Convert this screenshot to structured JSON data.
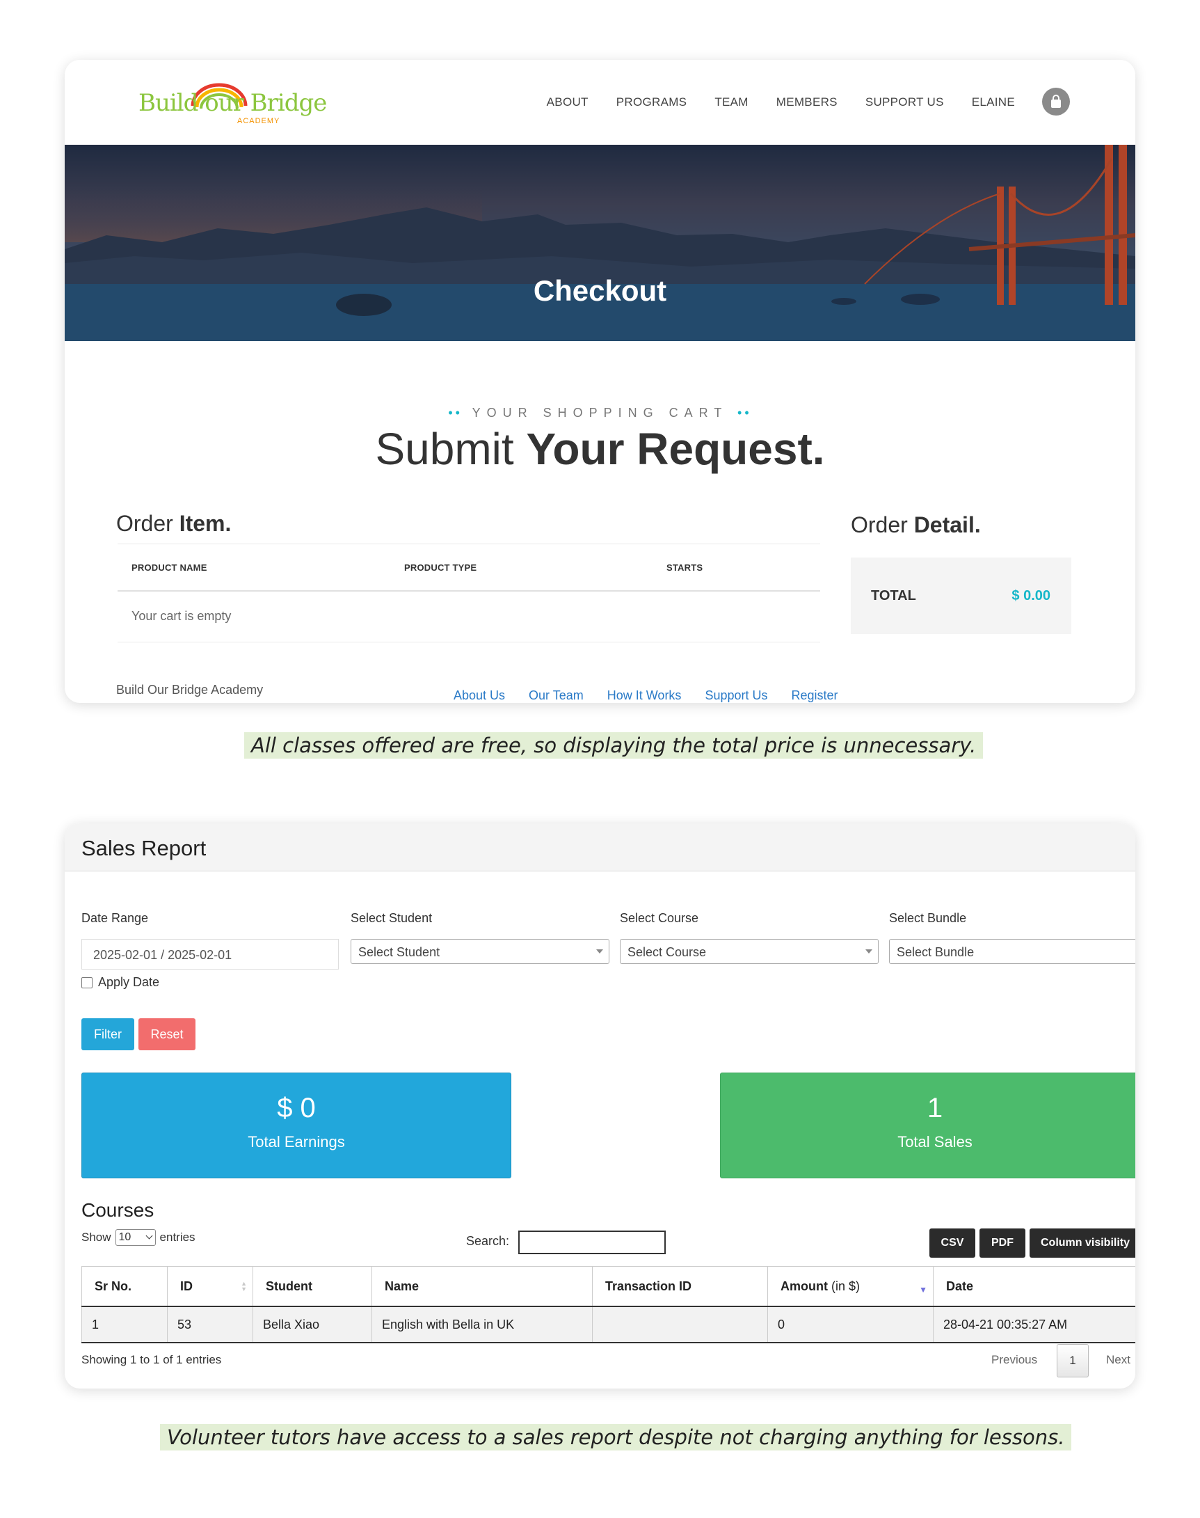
{
  "checkout": {
    "logo": {
      "text": "Build our Bridge",
      "sub": "ACADEMY"
    },
    "nav": [
      "ABOUT",
      "PROGRAMS",
      "TEAM",
      "MEMBERS",
      "SUPPORT US",
      "ELAINE"
    ],
    "hero_title": "Checkout",
    "eyebrow_dots": "••",
    "eyebrow": "YOUR SHOPPING CART",
    "title_light": "Submit ",
    "title_bold": "Your Request.",
    "order_item_light": "Order ",
    "order_item_bold": "Item.",
    "order_detail_light": "Order ",
    "order_detail_bold": "Detail.",
    "columns": [
      "PRODUCT NAME",
      "PRODUCT TYPE",
      "STARTS"
    ],
    "empty_message": "Your cart is empty",
    "total_label": "TOTAL",
    "total_value": "$ 0.00",
    "footer_brand": "Build Our Bridge Academy",
    "footer_links": [
      "About Us",
      "Our Team",
      "How It Works",
      "Support Us",
      "Register"
    ]
  },
  "caption1": "All classes offered are free, so displaying the total price is unnecessary.",
  "sales_report": {
    "title": "Sales Report",
    "filters": {
      "date_label": "Date Range",
      "date_value": "2025-02-01 / 2025-02-01",
      "student_label": "Select Student",
      "student_value": "Select Student",
      "course_label": "Select Course",
      "course_value": "Select Course",
      "bundle_label": "Select Bundle",
      "bundle_value": "Select Bundle",
      "apply_date": "Apply Date"
    },
    "filter_button": "Filter",
    "reset_button": "Reset",
    "earnings": {
      "value": "$ 0",
      "label": "Total Earnings"
    },
    "sales": {
      "value": "1",
      "label": "Total Sales"
    },
    "courses_title": "Courses",
    "show_label": "Show",
    "entries_value": "10",
    "entries_label": "entries",
    "search_label": "Search:",
    "export_buttons": [
      "CSV",
      "PDF",
      "Column visibility"
    ],
    "columns": [
      "Sr No.",
      "ID",
      "Student",
      "Name",
      "Transaction ID",
      "Amount",
      "Date"
    ],
    "amount_unit": "(in $)",
    "rows": [
      [
        "1",
        "53",
        "Bella Xiao",
        "English with Bella in UK",
        "",
        "0",
        "28-04-21 00:35:27 AM"
      ]
    ],
    "info": "Showing 1 to 1 of 1 entries",
    "previous": "Previous",
    "current_page": "1",
    "next": "Next"
  },
  "caption2": "Volunteer tutors have access to a sales report despite not charging anything for lessons.",
  "colors": {
    "accent_teal": "#16b7c9",
    "link_blue": "#2a7ac7",
    "filter_blue": "#24a6d9",
    "reset_red": "#f26d6d",
    "earnings_blue": "#22a7db",
    "sales_green": "#4cbb6c",
    "caption_bg": "#e3efd5"
  }
}
